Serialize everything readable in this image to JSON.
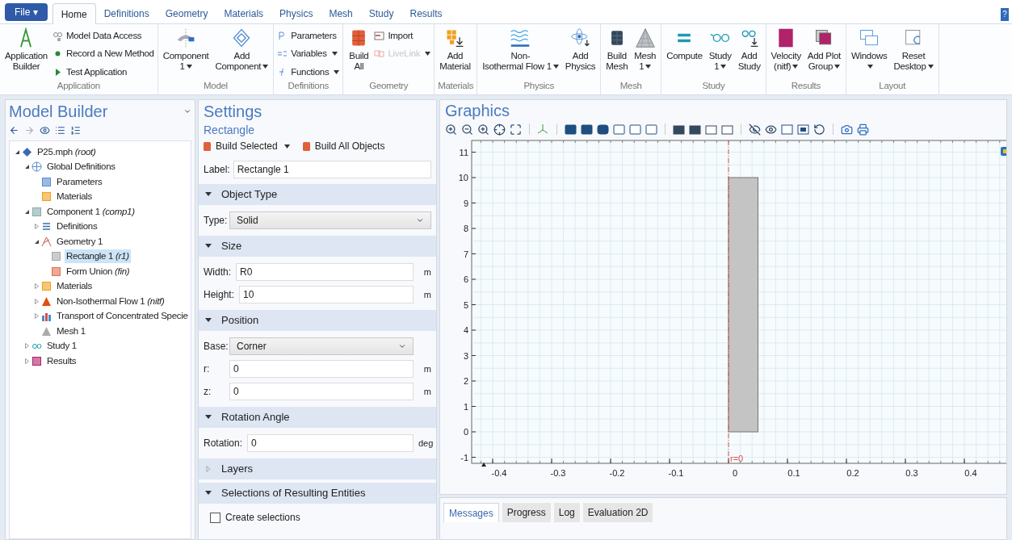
{
  "file_button": "File ▾",
  "menu_tabs": [
    {
      "label": "Home",
      "selected": true
    },
    {
      "label": "Definitions",
      "selected": false
    },
    {
      "label": "Geometry",
      "selected": false
    },
    {
      "label": "Materials",
      "selected": false
    },
    {
      "label": "Physics",
      "selected": false
    },
    {
      "label": "Mesh",
      "selected": false
    },
    {
      "label": "Study",
      "selected": false
    },
    {
      "label": "Results",
      "selected": false
    }
  ],
  "help_button": "?",
  "ribbon": [
    {
      "label": "Application",
      "items": [
        {
          "kind": "large",
          "lines": [
            "Application",
            "Builder"
          ],
          "dropdown": false
        },
        {
          "kind": "stack",
          "items": [
            {
              "label": "Model Data Access",
              "dropdown": false,
              "disabled": false
            },
            {
              "label": "Record a New Method",
              "dropdown": false,
              "disabled": false
            },
            {
              "label": "Test Application",
              "dropdown": false,
              "disabled": false
            }
          ]
        }
      ]
    },
    {
      "label": "Model",
      "items": [
        {
          "kind": "large",
          "lines": [
            "Component",
            "1"
          ],
          "dropdown": true
        },
        {
          "kind": "large",
          "lines": [
            "Add",
            "Component"
          ],
          "dropdown": true
        }
      ]
    },
    {
      "label": "Definitions",
      "items": [
        {
          "kind": "stack",
          "items": [
            {
              "label": "Parameters",
              "dropdown": false,
              "disabled": false
            },
            {
              "label": "Variables",
              "dropdown": true,
              "disabled": false
            },
            {
              "label": "Functions",
              "dropdown": true,
              "disabled": false
            }
          ]
        }
      ]
    },
    {
      "label": "Geometry",
      "items": [
        {
          "kind": "large",
          "lines": [
            "Build",
            "All"
          ],
          "dropdown": false
        },
        {
          "kind": "stack",
          "items": [
            {
              "label": "Import",
              "dropdown": false,
              "disabled": false
            },
            {
              "label": "LiveLink",
              "dropdown": true,
              "disabled": true
            }
          ]
        }
      ]
    },
    {
      "label": "Materials",
      "items": [
        {
          "kind": "large",
          "lines": [
            "Add",
            "Material"
          ],
          "dropdown": false
        }
      ]
    },
    {
      "label": "Physics",
      "items": [
        {
          "kind": "large",
          "lines": [
            "Non-",
            "Isothermal Flow 1"
          ],
          "dropdown": true
        },
        {
          "kind": "large",
          "lines": [
            "Add",
            "Physics"
          ],
          "dropdown": false
        }
      ]
    },
    {
      "label": "Mesh",
      "items": [
        {
          "kind": "large",
          "lines": [
            "Build",
            "Mesh"
          ],
          "dropdown": false
        },
        {
          "kind": "large",
          "lines": [
            "Mesh",
            "1"
          ],
          "dropdown": true
        }
      ]
    },
    {
      "label": "Study",
      "items": [
        {
          "kind": "large",
          "lines": [
            "Compute"
          ],
          "dropdown": false
        },
        {
          "kind": "large",
          "lines": [
            "Study",
            "1"
          ],
          "dropdown": true
        },
        {
          "kind": "large",
          "lines": [
            "Add",
            "Study"
          ],
          "dropdown": false
        }
      ]
    },
    {
      "label": "Results",
      "items": [
        {
          "kind": "large",
          "lines": [
            "Velocity",
            "(nitf)"
          ],
          "dropdown": true
        },
        {
          "kind": "large",
          "lines": [
            "Add Plot",
            "Group"
          ],
          "dropdown": true
        }
      ]
    },
    {
      "label": "Layout",
      "items": [
        {
          "kind": "large",
          "lines": [
            "Windows"
          ],
          "dropdown": true,
          "caret_on_own_line": true
        },
        {
          "kind": "large",
          "lines": [
            "Reset",
            "Desktop"
          ],
          "dropdown": true
        }
      ]
    }
  ],
  "model_builder": {
    "title": "Model Builder",
    "tree": [
      {
        "label": "P25.mph *(root)*",
        "expanded": true,
        "selected": false,
        "children": [
          {
            "label": "Global Definitions",
            "expanded": true,
            "selected": false,
            "children": [
              {
                "label": "Parameters",
                "selected": false
              },
              {
                "label": "Materials",
                "selected": false
              }
            ]
          },
          {
            "label": "Component 1 *(comp1)*",
            "expanded": true,
            "selected": false,
            "children": [
              {
                "label": "Definitions",
                "expanded": false,
                "selected": false
              },
              {
                "label": "Geometry 1",
                "expanded": true,
                "selected": false,
                "children": [
                  {
                    "label": "Rectangle 1 *(r1)*",
                    "selected": true
                  },
                  {
                    "label": "Form Union *(fin)*",
                    "selected": false
                  }
                ]
              },
              {
                "label": "Materials",
                "expanded": false,
                "selected": false
              },
              {
                "label": "Non-Isothermal Flow 1 *(nitf)*",
                "expanded": false,
                "selected": false
              },
              {
                "label": "Transport of Concentrated Specie",
                "expanded": false,
                "selected": false
              },
              {
                "label": "Mesh 1",
                "selected": false
              }
            ]
          },
          {
            "label": "Study 1",
            "expanded": false,
            "selected": false
          },
          {
            "label": "Results",
            "expanded": false,
            "selected": false
          }
        ]
      }
    ]
  },
  "settings": {
    "title": "Settings",
    "subtitle": "Rectangle",
    "actions": [
      {
        "label": "Build Selected",
        "dropdown": true
      },
      {
        "label": "Build All Objects",
        "dropdown": false
      }
    ],
    "label_field": {
      "label": "Label:",
      "value": "Rectangle 1"
    },
    "sections": [
      {
        "title": "Object Type",
        "expanded": true,
        "rows": [
          {
            "kind": "select",
            "label": "Type:",
            "value": "Solid"
          }
        ]
      },
      {
        "title": "Size",
        "expanded": true,
        "rows": [
          {
            "kind": "input",
            "label": "Width:",
            "value": "R0",
            "unit": "m"
          },
          {
            "kind": "input",
            "label": "Height:",
            "value": "10",
            "unit": "m"
          }
        ]
      },
      {
        "title": "Position",
        "expanded": true,
        "rows": [
          {
            "kind": "select",
            "label": "Base:",
            "value": "Corner"
          },
          {
            "kind": "input",
            "label": "r:",
            "value": "0",
            "unit": "m"
          },
          {
            "kind": "input",
            "label": "z:",
            "value": "0",
            "unit": "m"
          }
        ]
      },
      {
        "title": "Rotation Angle",
        "expanded": true,
        "rows": [
          {
            "kind": "input",
            "label": "Rotation:",
            "value": "0",
            "unit": "deg"
          }
        ]
      },
      {
        "title": "Layers",
        "expanded": false
      },
      {
        "title": "Selections of Resulting Entities",
        "expanded": true,
        "rows": [
          {
            "kind": "checkbox",
            "label": "Create selections",
            "checked": false
          }
        ]
      }
    ]
  },
  "graphics": {
    "title": "Graphics",
    "x_ticks": [
      "-0.4",
      "-0.3",
      "-0.2",
      "-0.1",
      "0",
      "0.1",
      "0.2",
      "0.3",
      "0.4"
    ],
    "y_ticks": [
      "11",
      "10",
      "9",
      "8",
      "7",
      "6",
      "5",
      "4",
      "3",
      "2",
      "1",
      "0",
      "-1"
    ],
    "axis_label": "r=0"
  },
  "bottom_tabs": [
    {
      "label": "Messages",
      "selected": true
    },
    {
      "label": "Progress",
      "selected": false
    },
    {
      "label": "Log",
      "selected": false
    },
    {
      "label": "Evaluation 2D",
      "selected": false
    }
  ]
}
